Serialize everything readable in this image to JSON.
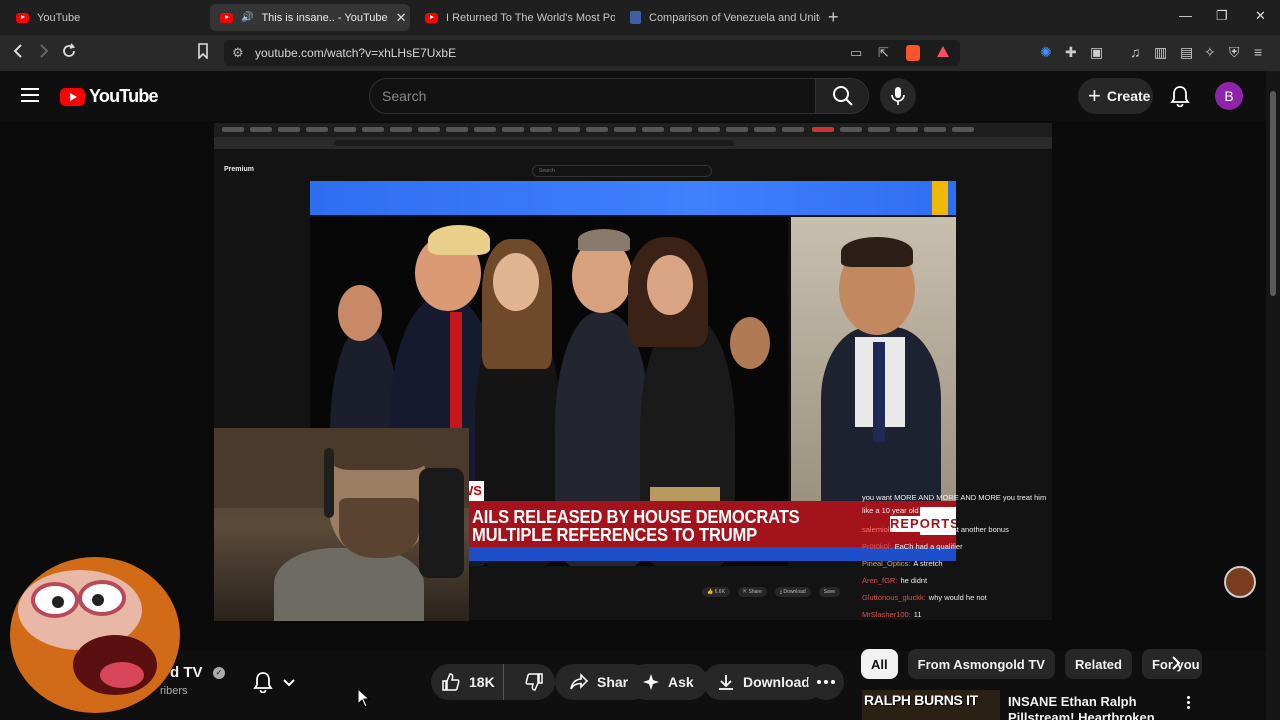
{
  "browser": {
    "tabs": [
      {
        "label": "YouTube",
        "active": false
      },
      {
        "label": "This is insane.. - YouTube",
        "active": true,
        "close": "✕"
      },
      {
        "label": "I Returned To The World's Most Pollu",
        "active": false
      },
      {
        "label": "Comparison of Venezuela and United",
        "active": false
      }
    ],
    "new_tab": "+",
    "url": "youtube.com/watch?v=xhLHsE7UxbE",
    "window_controls": {
      "minimize": "—",
      "maximize": "❐",
      "close": "✕"
    }
  },
  "masthead": {
    "logo_text": "YouTube",
    "search_placeholder": "Search",
    "create_label": "Create",
    "avatar_letter": "B"
  },
  "video": {
    "lower_third_line1": "AILS RELEASED BY HOUSE DEMOCRATS",
    "lower_third_line2": "MULTIPLE REFERENCES TO TRUMP",
    "lower_third_tag": "WS",
    "network_tag": "REPORTS",
    "recorded_logo": "Premium",
    "recorded_search": "Search",
    "chat": [
      {
        "user": "",
        "text": "you want MORE AND MORE AND MORE you treat him like a 10 year old",
        "color": "#ffffff"
      },
      {
        "user": "salemiol:",
        "text": "he didnt. It was just another bonus",
        "color": "#ff6b6b"
      },
      {
        "user": "Pr0t0k0l:",
        "text": "EaCh had a qualifier",
        "color": "#d9534f"
      },
      {
        "user": "Pineal_Optics:",
        "text": "A stretch",
        "color": "#e59b3a"
      },
      {
        "user": "Aren_fGR:",
        "text": "he didnt",
        "color": "#d9534f"
      },
      {
        "user": "Gluttonous_gluckk:",
        "text": "why would he not",
        "color": "#d9534f"
      },
      {
        "user": "MrSlasher100:",
        "text": "11",
        "color": "#d9534f"
      }
    ]
  },
  "below": {
    "channel_name_partial": "d TV",
    "subs_partial": "ribers",
    "like_count": "18K",
    "share_label": "Share",
    "ask_label": "Ask",
    "download_label": "Download"
  },
  "related": {
    "chips": [
      "All",
      "From Asmongold TV",
      "Related",
      "For you"
    ],
    "thumb_text": "RALPH BURNS IT",
    "title": "INSANE Ethan Ralph Pillstream! Heartbroken Ralph Crashes O"
  }
}
